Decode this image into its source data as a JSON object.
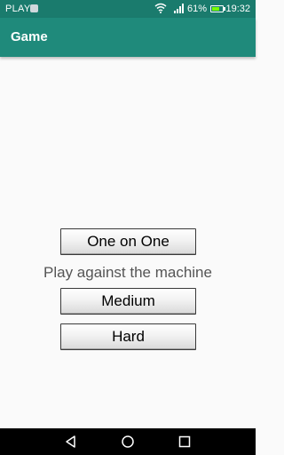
{
  "status_bar": {
    "carrier": "PLAY",
    "battery_percent": "61%",
    "time": "19:32",
    "battery_level": 0.61,
    "icons": [
      "sim-icon",
      "wifi-icon",
      "signal-icon",
      "battery-icon"
    ]
  },
  "app_bar": {
    "title": "Game",
    "color": "#1f8a7b"
  },
  "menu": {
    "one_on_one_label": "One on One",
    "caption": "Play against the machine",
    "medium_label": "Medium",
    "hard_label": "Hard"
  },
  "nav_bar": {
    "icons": [
      "back-icon",
      "home-icon",
      "recents-icon"
    ]
  }
}
